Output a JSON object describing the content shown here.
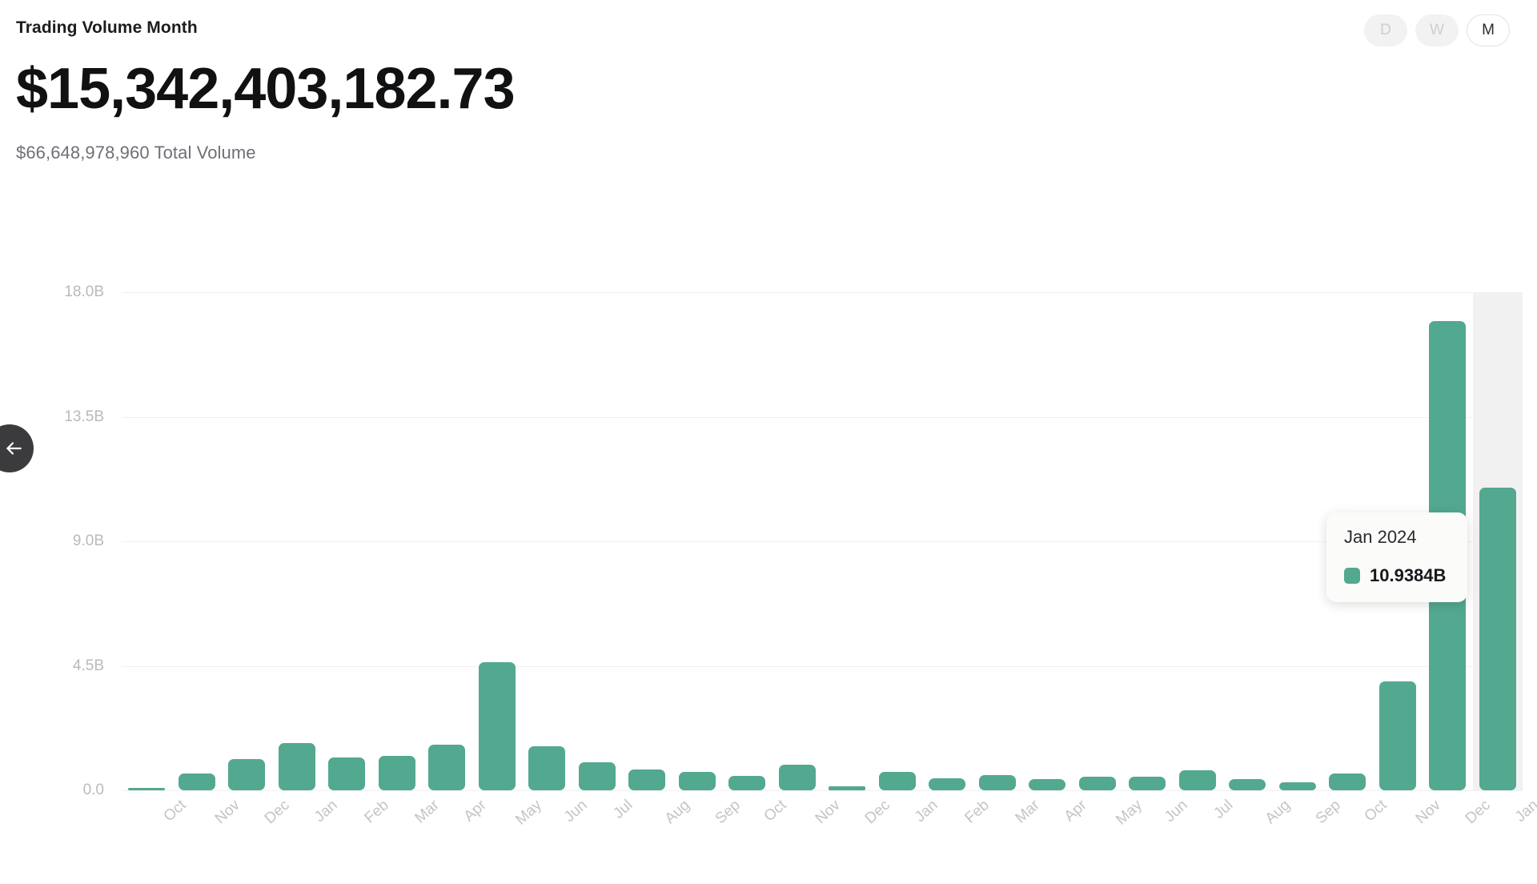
{
  "card": {
    "title": "Trading Volume Month",
    "primary_value": "$15,342,403,182.73",
    "secondary_value": "$66,648,978,960 Total Volume"
  },
  "range_toggle": {
    "options": [
      {
        "label": "D",
        "name": "day",
        "active": false
      },
      {
        "label": "W",
        "name": "week",
        "active": false
      },
      {
        "label": "M",
        "name": "month",
        "active": true
      }
    ]
  },
  "back_button": {
    "icon": "arrow-left-icon"
  },
  "tooltip": {
    "title": "Jan 2024",
    "value": "10.9384B",
    "swatch_color": "#53a890",
    "target_index": 27
  },
  "colors": {
    "bar": "#53a890",
    "gridline": "#f0f0f1",
    "hover_band": "#f1f1f2",
    "axis_text": "#c3c4c7"
  },
  "chart_data": {
    "type": "bar",
    "title": "Trading Volume Month",
    "xlabel": "",
    "ylabel": "",
    "ylim": [
      0,
      18
    ],
    "yticks": [
      0,
      4.5,
      9.0,
      13.5,
      18.0
    ],
    "ytick_labels": [
      "0.0",
      "4.5B",
      "9.0B",
      "13.5B",
      "18.0B"
    ],
    "grid": true,
    "legend": false,
    "unit": "B",
    "categories": [
      "Oct",
      "Nov",
      "Dec",
      "Jan",
      "Feb",
      "Mar",
      "Apr",
      "May",
      "Jun",
      "Jul",
      "Aug",
      "Sep",
      "Oct",
      "Nov",
      "Dec",
      "Jan",
      "Feb",
      "Mar",
      "Apr",
      "May",
      "Jun",
      "Jul",
      "Aug",
      "Sep",
      "Oct",
      "Nov",
      "Dec",
      "Jan"
    ],
    "values": [
      0.02,
      0.62,
      1.12,
      1.72,
      1.2,
      1.25,
      1.66,
      4.62,
      1.58,
      1.0,
      0.76,
      0.68,
      0.52,
      0.92,
      0.14,
      0.68,
      0.44,
      0.56,
      0.42,
      0.48,
      0.5,
      0.72,
      0.42,
      0.3,
      0.62,
      3.95,
      16.95,
      10.94
    ]
  }
}
